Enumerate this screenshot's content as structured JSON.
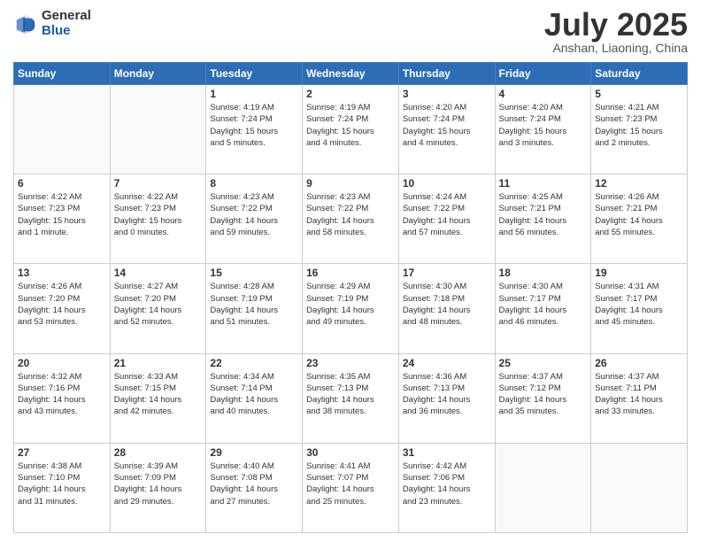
{
  "header": {
    "logo_general": "General",
    "logo_blue": "Blue",
    "title": "July 2025",
    "location": "Anshan, Liaoning, China"
  },
  "weekdays": [
    "Sunday",
    "Monday",
    "Tuesday",
    "Wednesday",
    "Thursday",
    "Friday",
    "Saturday"
  ],
  "weeks": [
    [
      {
        "day": "",
        "info": ""
      },
      {
        "day": "",
        "info": ""
      },
      {
        "day": "1",
        "info": "Sunrise: 4:19 AM\nSunset: 7:24 PM\nDaylight: 15 hours\nand 5 minutes."
      },
      {
        "day": "2",
        "info": "Sunrise: 4:19 AM\nSunset: 7:24 PM\nDaylight: 15 hours\nand 4 minutes."
      },
      {
        "day": "3",
        "info": "Sunrise: 4:20 AM\nSunset: 7:24 PM\nDaylight: 15 hours\nand 4 minutes."
      },
      {
        "day": "4",
        "info": "Sunrise: 4:20 AM\nSunset: 7:24 PM\nDaylight: 15 hours\nand 3 minutes."
      },
      {
        "day": "5",
        "info": "Sunrise: 4:21 AM\nSunset: 7:23 PM\nDaylight: 15 hours\nand 2 minutes."
      }
    ],
    [
      {
        "day": "6",
        "info": "Sunrise: 4:22 AM\nSunset: 7:23 PM\nDaylight: 15 hours\nand 1 minute."
      },
      {
        "day": "7",
        "info": "Sunrise: 4:22 AM\nSunset: 7:23 PM\nDaylight: 15 hours\nand 0 minutes."
      },
      {
        "day": "8",
        "info": "Sunrise: 4:23 AM\nSunset: 7:22 PM\nDaylight: 14 hours\nand 59 minutes."
      },
      {
        "day": "9",
        "info": "Sunrise: 4:23 AM\nSunset: 7:22 PM\nDaylight: 14 hours\nand 58 minutes."
      },
      {
        "day": "10",
        "info": "Sunrise: 4:24 AM\nSunset: 7:22 PM\nDaylight: 14 hours\nand 57 minutes."
      },
      {
        "day": "11",
        "info": "Sunrise: 4:25 AM\nSunset: 7:21 PM\nDaylight: 14 hours\nand 56 minutes."
      },
      {
        "day": "12",
        "info": "Sunrise: 4:26 AM\nSunset: 7:21 PM\nDaylight: 14 hours\nand 55 minutes."
      }
    ],
    [
      {
        "day": "13",
        "info": "Sunrise: 4:26 AM\nSunset: 7:20 PM\nDaylight: 14 hours\nand 53 minutes."
      },
      {
        "day": "14",
        "info": "Sunrise: 4:27 AM\nSunset: 7:20 PM\nDaylight: 14 hours\nand 52 minutes."
      },
      {
        "day": "15",
        "info": "Sunrise: 4:28 AM\nSunset: 7:19 PM\nDaylight: 14 hours\nand 51 minutes."
      },
      {
        "day": "16",
        "info": "Sunrise: 4:29 AM\nSunset: 7:19 PM\nDaylight: 14 hours\nand 49 minutes."
      },
      {
        "day": "17",
        "info": "Sunrise: 4:30 AM\nSunset: 7:18 PM\nDaylight: 14 hours\nand 48 minutes."
      },
      {
        "day": "18",
        "info": "Sunrise: 4:30 AM\nSunset: 7:17 PM\nDaylight: 14 hours\nand 46 minutes."
      },
      {
        "day": "19",
        "info": "Sunrise: 4:31 AM\nSunset: 7:17 PM\nDaylight: 14 hours\nand 45 minutes."
      }
    ],
    [
      {
        "day": "20",
        "info": "Sunrise: 4:32 AM\nSunset: 7:16 PM\nDaylight: 14 hours\nand 43 minutes."
      },
      {
        "day": "21",
        "info": "Sunrise: 4:33 AM\nSunset: 7:15 PM\nDaylight: 14 hours\nand 42 minutes."
      },
      {
        "day": "22",
        "info": "Sunrise: 4:34 AM\nSunset: 7:14 PM\nDaylight: 14 hours\nand 40 minutes."
      },
      {
        "day": "23",
        "info": "Sunrise: 4:35 AM\nSunset: 7:13 PM\nDaylight: 14 hours\nand 38 minutes."
      },
      {
        "day": "24",
        "info": "Sunrise: 4:36 AM\nSunset: 7:13 PM\nDaylight: 14 hours\nand 36 minutes."
      },
      {
        "day": "25",
        "info": "Sunrise: 4:37 AM\nSunset: 7:12 PM\nDaylight: 14 hours\nand 35 minutes."
      },
      {
        "day": "26",
        "info": "Sunrise: 4:37 AM\nSunset: 7:11 PM\nDaylight: 14 hours\nand 33 minutes."
      }
    ],
    [
      {
        "day": "27",
        "info": "Sunrise: 4:38 AM\nSunset: 7:10 PM\nDaylight: 14 hours\nand 31 minutes."
      },
      {
        "day": "28",
        "info": "Sunrise: 4:39 AM\nSunset: 7:09 PM\nDaylight: 14 hours\nand 29 minutes."
      },
      {
        "day": "29",
        "info": "Sunrise: 4:40 AM\nSunset: 7:08 PM\nDaylight: 14 hours\nand 27 minutes."
      },
      {
        "day": "30",
        "info": "Sunrise: 4:41 AM\nSunset: 7:07 PM\nDaylight: 14 hours\nand 25 minutes."
      },
      {
        "day": "31",
        "info": "Sunrise: 4:42 AM\nSunset: 7:06 PM\nDaylight: 14 hours\nand 23 minutes."
      },
      {
        "day": "",
        "info": ""
      },
      {
        "day": "",
        "info": ""
      }
    ]
  ]
}
